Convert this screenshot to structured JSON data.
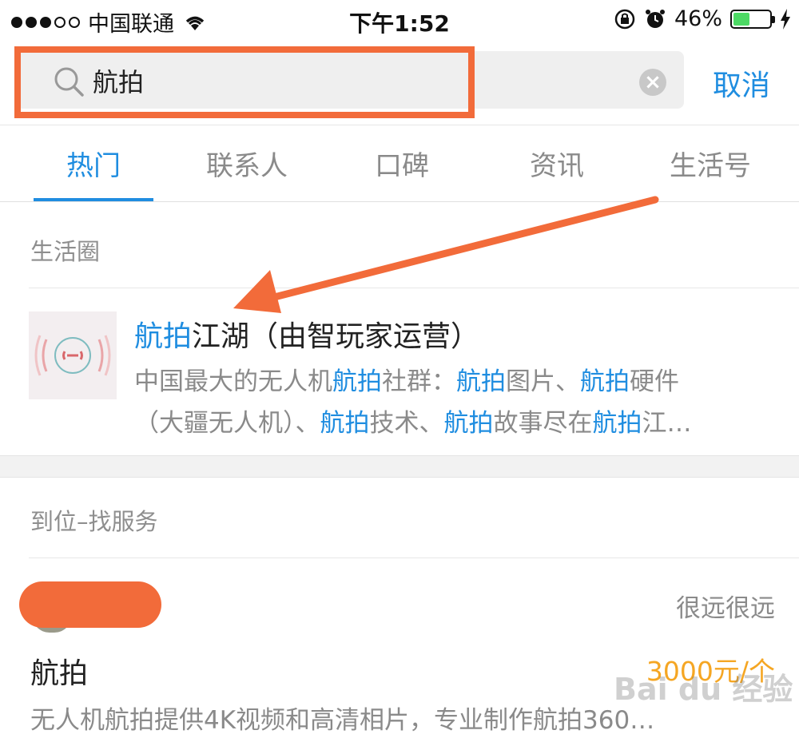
{
  "status_bar": {
    "carrier": "中国联通",
    "time": "下午1:52",
    "battery": "46%",
    "battery_level": 0.46
  },
  "search": {
    "query": "航拍",
    "cancel_label": "取消"
  },
  "tabs": [
    {
      "label": "热门",
      "active": true
    },
    {
      "label": "联系人",
      "active": false
    },
    {
      "label": "口碑",
      "active": false
    },
    {
      "label": "资讯",
      "active": false
    },
    {
      "label": "生活号",
      "active": false
    }
  ],
  "life_circle": {
    "section_title": "生活圈",
    "result": {
      "title_hl": "航拍",
      "title_rest": "江湖（由智玩家运营）",
      "desc_line1": [
        {
          "t": "中国最大的无人机",
          "hl": false
        },
        {
          "t": "航拍",
          "hl": true
        },
        {
          "t": "社群：",
          "hl": false
        },
        {
          "t": "航拍",
          "hl": true
        },
        {
          "t": "图片、",
          "hl": false
        },
        {
          "t": "航拍",
          "hl": true
        },
        {
          "t": "硬件",
          "hl": false
        }
      ],
      "desc_line2": [
        {
          "t": "（大疆无人机）、",
          "hl": false
        },
        {
          "t": "航拍",
          "hl": true
        },
        {
          "t": "技术、",
          "hl": false
        },
        {
          "t": "航拍",
          "hl": true
        },
        {
          "t": "故事尽在",
          "hl": false
        },
        {
          "t": "航拍",
          "hl": true
        },
        {
          "t": "江…",
          "hl": false
        }
      ]
    }
  },
  "services": {
    "section_title": "到位–找服务",
    "item": {
      "distance": "很远很远",
      "title": "航拍",
      "price": "3000元/个",
      "description": "无人机航拍提供4K视频和高清相片，专业制作航拍360…"
    }
  },
  "watermark": "Bai du 经验"
}
